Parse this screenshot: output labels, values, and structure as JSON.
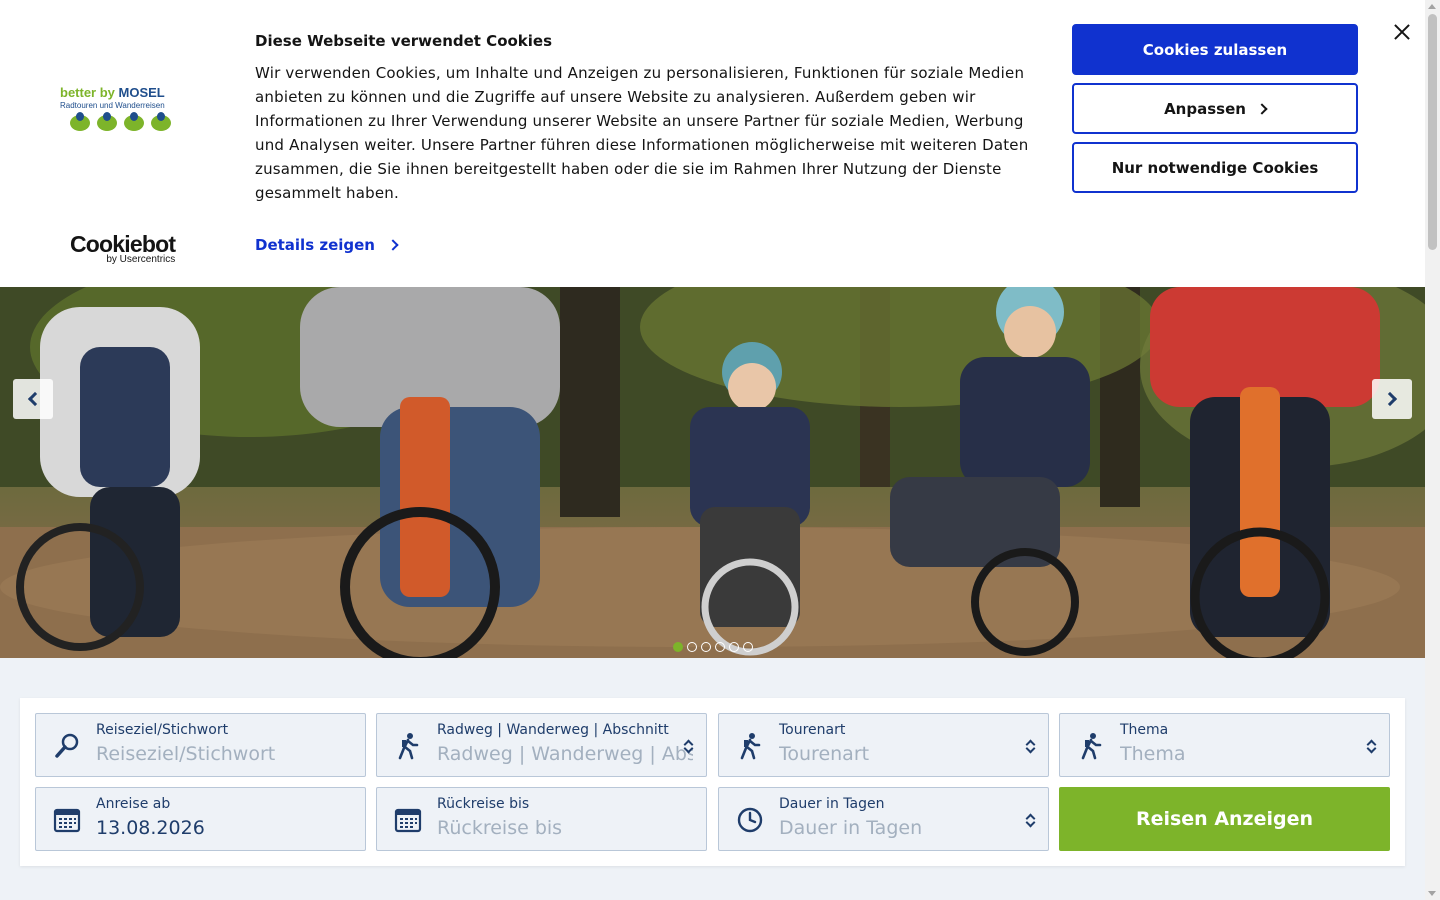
{
  "cookie_banner": {
    "title": "Diese Webseite verwendet Cookies",
    "text": "Wir verwenden Cookies, um Inhalte und Anzeigen zu personalisieren, Funktionen für soziale Medien anbieten zu können und die Zugriffe auf unsere Website zu analysieren. Außerdem geben wir Informationen zu Ihrer Verwendung unserer Website an unsere Partner für soziale Medien, Werbung und Analysen weiter. Unsere Partner führen diese Informationen möglicherweise mit weiteren Daten zusammen, die Sie ihnen bereitgestellt haben oder die sie im Rahmen Ihrer Nutzung der Dienste gesammelt haben.",
    "details_link": "Details zeigen",
    "allow_button": "Cookies zulassen",
    "customize_button": "Anpassen",
    "necessary_button": "Nur notwendige Cookies",
    "brand": {
      "name_part1": "better by ",
      "name_part2": "MOSEL",
      "tagline": "Radtouren und Wanderreisen"
    },
    "powered_by": {
      "name": "Cookiebot",
      "sub": "by Usercentrics"
    }
  },
  "colors": {
    "primary_blue": "#1032cf",
    "brand_green": "#7db42a",
    "navy": "#1f3d6b",
    "field_bg": "#eef2f7"
  },
  "hero": {
    "slides_total": 6,
    "active_slide": 1
  },
  "search": {
    "fields": [
      {
        "label": "Reiseziel/Stichwort",
        "value": "Reiseziel/Stichwort",
        "icon": "search-icon"
      },
      {
        "label": "Radweg | Wanderweg | Abschnitt",
        "value": "Radweg | Wanderweg | Abschnitt",
        "icon": "hiker-icon"
      },
      {
        "label": "Tourenart",
        "value": "Tourenart",
        "icon": "hiker-icon"
      },
      {
        "label": "Thema",
        "value": "Thema",
        "icon": "hiker-icon"
      },
      {
        "label": "Anreise ab",
        "value": "13.08.2026",
        "icon": "calendar-icon"
      },
      {
        "label": "Rückreise bis",
        "value": "Rückreise bis",
        "icon": "calendar-icon"
      },
      {
        "label": "Dauer in Tagen",
        "value": "Dauer in Tagen",
        "icon": "clock-icon"
      }
    ],
    "submit_label": "Reisen Anzeigen"
  }
}
